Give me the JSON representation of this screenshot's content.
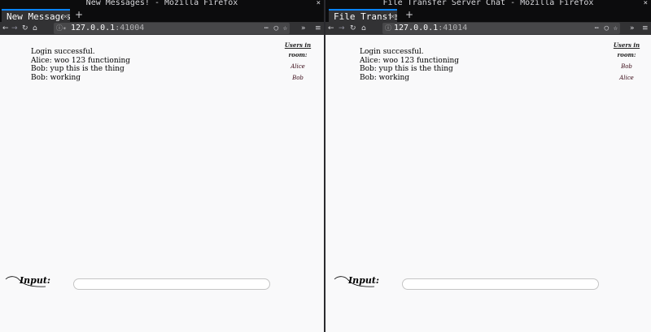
{
  "windows": [
    {
      "title": "New Messages! - Mozilla Firefox",
      "close_glyph": "×",
      "tab_label": "New Messages",
      "new_tab": "+",
      "url_host": "127.0.0.1",
      "url_port": ":41004",
      "messages": [
        "Login successful.",
        "Alice: woo 123 functioning",
        "Bob: yup this is the thing",
        "Bob: working"
      ],
      "users_header": "Users in",
      "room_label": "room:",
      "users": [
        "Alice",
        "Bob"
      ],
      "input_label": "Input:",
      "input_value": ""
    },
    {
      "title": "File Transfer Server Chat - Mozilla Firefox",
      "close_glyph": "×",
      "tab_label": "File Transfe",
      "new_tab": "+",
      "url_host": "127.0.0.1",
      "url_port": ":41014",
      "messages": [
        "Login successful.",
        "Alice: woo 123 functioning",
        "Bob: yup this is the thing",
        "Bob: working"
      ],
      "users_header": "Users in",
      "room_label": "room:",
      "users": [
        "Bob",
        "Alice"
      ],
      "input_label": "Input:",
      "input_value": ""
    }
  ],
  "icons": {
    "back": "back-arrow-icon",
    "forward": "forward-arrow-icon",
    "reload": "reload-icon",
    "home": "home-icon",
    "info": "info-icon",
    "more": "page-actions-icon",
    "pocket": "pocket-icon",
    "star": "bookmark-star-icon",
    "overflow": "overflow-chevron-icon",
    "menu": "hamburger-menu-icon"
  },
  "colors": {
    "tab_accent": "#0a84ff",
    "chrome_dark": "#0c0c0d",
    "toolbar": "#323234",
    "urlbar": "#474749",
    "page_bg": "#f9f9fa"
  }
}
